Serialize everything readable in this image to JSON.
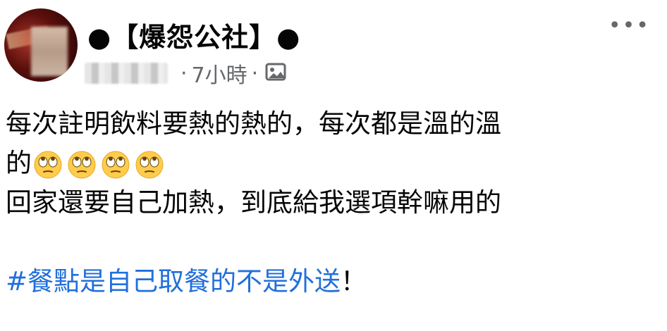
{
  "post": {
    "page_name": "●【爆怨公社】●",
    "timestamp": "7小時",
    "separator": "·",
    "audience_icon": "photo-icon",
    "more_label": "•••",
    "lines": {
      "line1": "每次註明飲料要熱的熱的，每次都是溫的溫",
      "line2": "的",
      "line3": "回家還要自己加熱，到底給我選項幹嘛用的"
    },
    "emoji_name": "face-with-rolling-eyes",
    "emoji_count": 4,
    "hashtag": "#餐點是自己取餐的不是外送",
    "hashtag_suffix": "！"
  },
  "colors": {
    "text": "#050505",
    "meta": "#65676b",
    "link": "#216fdb"
  }
}
